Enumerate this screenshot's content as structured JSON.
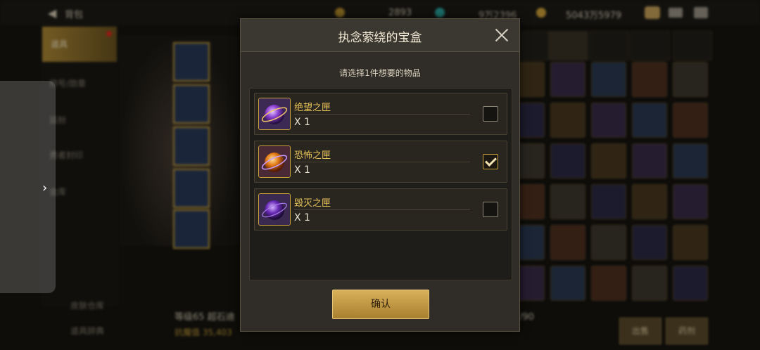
{
  "background": {
    "back_label": "背包",
    "currency_1": "2893",
    "currency_2": "9万2396",
    "currency_3": "5043万5979",
    "sidebar_items": [
      "道具",
      "称号/勋章",
      "装扮",
      "勇者封印",
      "金库"
    ],
    "sidebar_footer": [
      "皮肤仓库",
      "道具辞典"
    ],
    "char_info": "等级65 超石迪",
    "char_stat": "抗魔值 35,403",
    "count_text": "/90",
    "sell_label": "出售",
    "potion_label": "药剂"
  },
  "modal": {
    "title": "执念萦绕的宝盒",
    "subtitle": "请选择1件想要的物品",
    "options": [
      {
        "name": "绝望之匣",
        "qty": "X 1",
        "checked": false
      },
      {
        "name": "恐怖之匣",
        "qty": "X 1",
        "checked": true
      },
      {
        "name": "毁灭之匣",
        "qty": "X 1",
        "checked": false
      }
    ],
    "confirm_label": "确认"
  },
  "icons": [
    "close-icon",
    "checkmark-icon",
    "box-orb-icon"
  ],
  "colors": {
    "accent_gold": "#c9a23c",
    "name_gold": "#e7c35a",
    "confirm_gold": "#d9b15b"
  }
}
